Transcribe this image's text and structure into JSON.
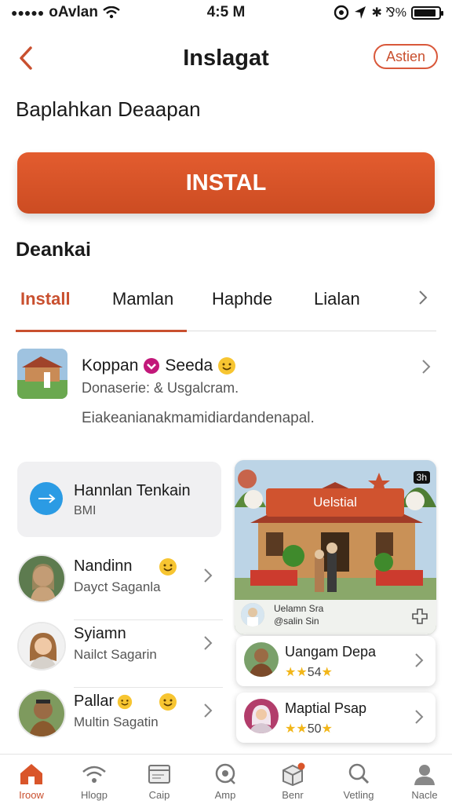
{
  "status_bar": {
    "carrier": "oAvlan",
    "time": "4:5 M",
    "right_glyphs": "✱ ⅋%"
  },
  "header": {
    "title": "Inslagat",
    "pill_label": "Astien"
  },
  "subtitle": "Baplahkan Deaapan",
  "install_button": "INSTAL",
  "section_title": "Deankai",
  "tabs": [
    {
      "label": "Install"
    },
    {
      "label": "Mamlan"
    },
    {
      "label": "Haphde"
    },
    {
      "label": "Lialan"
    }
  ],
  "feature": {
    "name_part1": "Koppan",
    "name_part2": "Seeda",
    "subtitle": "Donaserie: & Usgalcram.",
    "description": "Eiakeanianakmamidiardandenapal."
  },
  "card_gray": {
    "title": "Hannlan Tenkain",
    "subtitle": "BMI"
  },
  "people": [
    {
      "name": "Nandinn",
      "subtitle": "Dayct Saganla"
    },
    {
      "name": "Syiamn",
      "subtitle": "Nailct Sagarin"
    },
    {
      "name": "Pallar",
      "subtitle": "Multin Sagatin"
    }
  ],
  "photo_card": {
    "banner": "Uelstial",
    "corner_badge": "3h",
    "line1": "Uelamn Sra",
    "line2": "@salin Sin"
  },
  "mini_cards": [
    {
      "name": "Uangam Depa",
      "stars": "★★",
      "rating": "54",
      "star_after": "★"
    },
    {
      "name": "Maptial Psap",
      "stars": "★★",
      "rating": "50",
      "star_after": "★"
    }
  ],
  "nav": [
    {
      "label": "Iroow",
      "icon": "home-icon"
    },
    {
      "label": "Hlogp",
      "icon": "wifi-icon"
    },
    {
      "label": "Caip",
      "icon": "card-icon"
    },
    {
      "label": "Amp",
      "icon": "search-circle-icon"
    },
    {
      "label": "Benr",
      "icon": "box-icon"
    },
    {
      "label": "Vetling",
      "icon": "search-icon"
    },
    {
      "label": "Nacle",
      "icon": "profile-icon"
    }
  ],
  "colors": {
    "accent": "#c9502f",
    "install_bg": "#d9552a",
    "info_blue": "#2b9be4",
    "star": "#f2b619"
  },
  "battery_level": 0.9
}
